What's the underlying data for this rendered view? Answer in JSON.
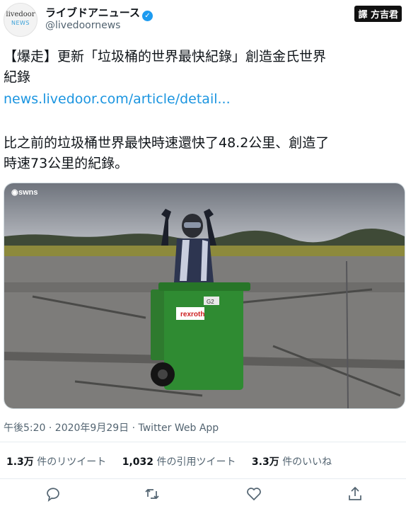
{
  "account": {
    "name": "ライブドアニュース",
    "handle": "@livedoornews",
    "avatar_line1": "livedoor",
    "avatar_line2": "NEWS"
  },
  "watermark": "譯 方吉君",
  "tweet": {
    "line1": "【爆走】更新「垃圾桶的世界最快紀錄」創造金氏世界",
    "line2": "紀錄",
    "link": "news.livedoor.com/article/detail...",
    "body_line1": "比之前的垃圾桶世界最快時速還快了48.2公里、創造了",
    "body_line2": "時速73公里的紀錄。"
  },
  "media": {
    "credit": "swns",
    "bin_label": "rexroth",
    "bin_tag": "G2"
  },
  "meta": "午後5:20 · 2020年9月29日 · Twitter Web App",
  "stats": {
    "retweets_count": "1.3万",
    "retweets_label": "件のリツイート",
    "quotes_count": "1,032",
    "quotes_label": "件の引用ツイート",
    "likes_count": "3.3万",
    "likes_label": "件のいいね"
  },
  "icons": [
    "reply-icon",
    "retweet-icon",
    "like-icon",
    "share-icon",
    "verified-icon"
  ],
  "colors": {
    "link": "#1b95e0",
    "verified": "#1d9bf0",
    "muted": "#536471"
  }
}
